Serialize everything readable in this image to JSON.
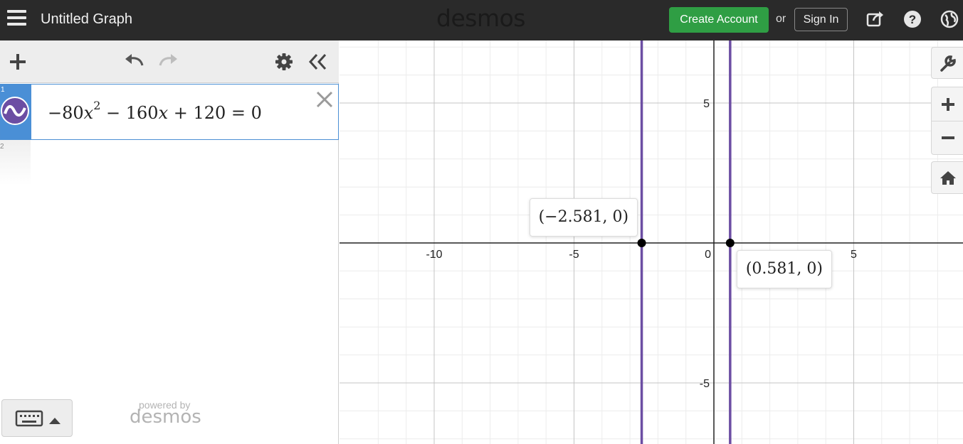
{
  "header": {
    "title": "Untitled Graph",
    "logo": "desmos",
    "create_account": "Create Account",
    "or": "or",
    "sign_in": "Sign In",
    "icons": [
      "menu-icon",
      "share-icon",
      "help-icon",
      "language-icon"
    ]
  },
  "toolbar": {
    "icons": [
      "add-icon",
      "undo-icon",
      "redo-icon",
      "settings-icon",
      "collapse-icon"
    ]
  },
  "expressions": [
    {
      "index": "1",
      "latex": "−80x^2 − 160x + 120 = 0",
      "color": "#6c4ea3"
    },
    {
      "index": "2",
      "latex": ""
    }
  ],
  "footer": {
    "powered_by": "powered by",
    "logo": "desmos",
    "keyboard_icon": "keyboard-icon"
  },
  "graph": {
    "x_ticks": [
      "-10",
      "-5",
      "0",
      "5"
    ],
    "y_ticks": [
      "5",
      "-5"
    ],
    "x_range": [
      -12.5,
      9.5
    ],
    "y_range": [
      -7.2,
      7.1
    ],
    "grid": true,
    "minor_step": 1,
    "major_step": 5,
    "curve_color": "#6c4ea3",
    "vertical_lines_x": [
      -2.581,
      0.581
    ],
    "points": [
      {
        "label": "(−2.581, 0)",
        "x": -2.581,
        "y": 0
      },
      {
        "label": "(0.581, 0)",
        "x": 0.581,
        "y": 0
      }
    ]
  },
  "graph_controls": [
    "wrench-icon",
    "zoom-in-icon",
    "zoom-out-icon",
    "home-icon"
  ]
}
